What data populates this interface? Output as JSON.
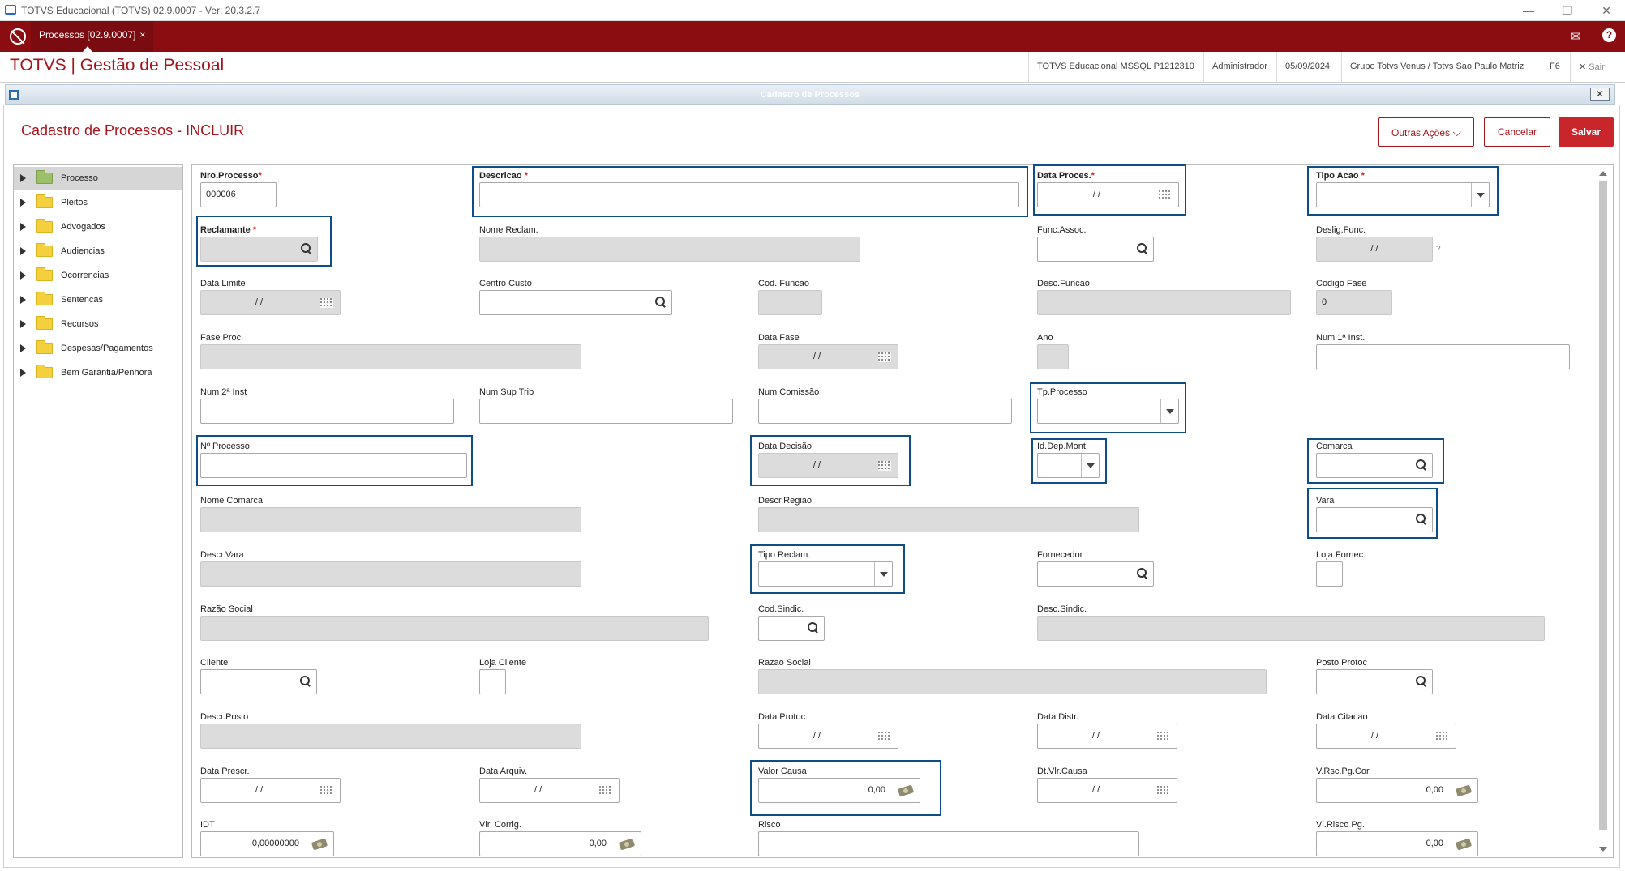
{
  "window": {
    "title": "TOTVS Educacional (TOTVS) 02.9.0007 - Ver: 20.3.2.7"
  },
  "topbar": {
    "tab_label": "Processos [02.9.0007]",
    "tab_close": "×"
  },
  "header": {
    "brand": "TOTVS | Gestão de Pessoal",
    "env": "TOTVS Educacional MSSQL P1212310",
    "user": "Administrador",
    "date": "05/09/2024",
    "company": "Grupo Totvs Venus / Totvs Sao Paulo Matriz",
    "shortcut": "F6",
    "exit": "Sair"
  },
  "dialog": {
    "title": "Cadastro de Processos",
    "close": "✕"
  },
  "form": {
    "title": "Cadastro de Processos - INCLUIR",
    "outras_acoes": "Outras Ações",
    "cancelar": "Cancelar",
    "salvar": "Salvar"
  },
  "tree": {
    "items": [
      "Processo",
      "Pleitos",
      "Advogados",
      "Audiencias",
      "Ocorrencias",
      "Sentencas",
      "Recursos",
      "Despesas/Pagamentos",
      "Bem Garantia/Penhora"
    ]
  },
  "fields": {
    "nro_processo": {
      "label": "Nro.Processo",
      "value": "000006"
    },
    "descricao": {
      "label": "Descricao",
      "value": ""
    },
    "data_proces": {
      "label": "Data Proces.",
      "value": "/ /"
    },
    "tipo_acao": {
      "label": "Tipo Acao",
      "value": ""
    },
    "reclamante": {
      "label": "Reclamante",
      "value": ""
    },
    "nome_reclam": {
      "label": "Nome Reclam.",
      "value": ""
    },
    "func_assoc": {
      "label": "Func.Assoc.",
      "value": ""
    },
    "deslig_func": {
      "label": "Deslig.Func.",
      "value": "/ /",
      "help": "?"
    },
    "data_limite": {
      "label": "Data Limite",
      "value": "/ /"
    },
    "centro_custo": {
      "label": "Centro Custo",
      "value": ""
    },
    "cod_funcao": {
      "label": "Cod. Funcao",
      "value": ""
    },
    "desc_funcao": {
      "label": "Desc.Funcao",
      "value": ""
    },
    "codigo_fase": {
      "label": "Codigo Fase",
      "value": "0"
    },
    "fase_proc": {
      "label": "Fase Proc.",
      "value": ""
    },
    "data_fase": {
      "label": "Data Fase",
      "value": "/ /"
    },
    "ano": {
      "label": "Ano",
      "value": ""
    },
    "num_1_inst": {
      "label": "Num 1ª Inst.",
      "value": ""
    },
    "num_2_inst": {
      "label": "Num 2ª Inst",
      "value": ""
    },
    "num_sup_trib": {
      "label": "Num Sup Trib",
      "value": ""
    },
    "num_comissao": {
      "label": "Num Comissão",
      "value": ""
    },
    "tp_processo": {
      "label": "Tp.Processo",
      "value": ""
    },
    "n_processo": {
      "label": "Nº Processo",
      "value": ""
    },
    "data_decisao": {
      "label": "Data Decisão",
      "value": "/ /"
    },
    "id_dep_mont": {
      "label": "Id.Dep.Mont",
      "value": ""
    },
    "comarca": {
      "label": "Comarca",
      "value": ""
    },
    "nome_comarca": {
      "label": "Nome Comarca",
      "value": ""
    },
    "descr_regiao": {
      "label": "Descr.Regiao",
      "value": ""
    },
    "vara": {
      "label": "Vara",
      "value": ""
    },
    "descr_vara": {
      "label": "Descr.Vara",
      "value": ""
    },
    "tipo_reclam": {
      "label": "Tipo Reclam.",
      "value": ""
    },
    "fornecedor": {
      "label": "Fornecedor",
      "value": ""
    },
    "loja_fornec": {
      "label": "Loja Fornec.",
      "value": ""
    },
    "razao_social": {
      "label": "Razão Social",
      "value": ""
    },
    "cod_sindic": {
      "label": "Cod.Sindic.",
      "value": ""
    },
    "desc_sindic": {
      "label": "Desc.Sindic.",
      "value": ""
    },
    "cliente": {
      "label": "Cliente",
      "value": ""
    },
    "loja_cliente": {
      "label": "Loja Cliente",
      "value": ""
    },
    "razao_social2": {
      "label": "Razao Social",
      "value": ""
    },
    "posto_protoc": {
      "label": "Posto Protoc",
      "value": ""
    },
    "descr_posto": {
      "label": "Descr.Posto",
      "value": ""
    },
    "data_protoc": {
      "label": "Data Protoc.",
      "value": "/ /"
    },
    "data_distr": {
      "label": "Data Distr.",
      "value": "/ /"
    },
    "data_citacao": {
      "label": "Data Citacao",
      "value": "/ /"
    },
    "data_prescr": {
      "label": "Data Prescr.",
      "value": "/ /"
    },
    "data_arquiv": {
      "label": "Data Arquiv.",
      "value": "/ /"
    },
    "valor_causa": {
      "label": "Valor Causa",
      "value": "0,00"
    },
    "dt_vlr_causa": {
      "label": "Dt.Vlr.Causa",
      "value": "/ /"
    },
    "v_rsc_pg_cor": {
      "label": "V.Rsc.Pg.Cor",
      "value": "0,00"
    },
    "idt": {
      "label": "IDT",
      "value": "0,00000000"
    },
    "vlr_corrig": {
      "label": "Vlr. Corrig.",
      "value": "0,00"
    },
    "risco": {
      "label": "Risco",
      "value": ""
    },
    "vl_risco_pg": {
      "label": "Vl.Risco Pg.",
      "value": "0,00"
    }
  },
  "colors": {
    "brand": "#8b0d12",
    "accent": "#c9262c",
    "highlight": "#0f4d86"
  }
}
